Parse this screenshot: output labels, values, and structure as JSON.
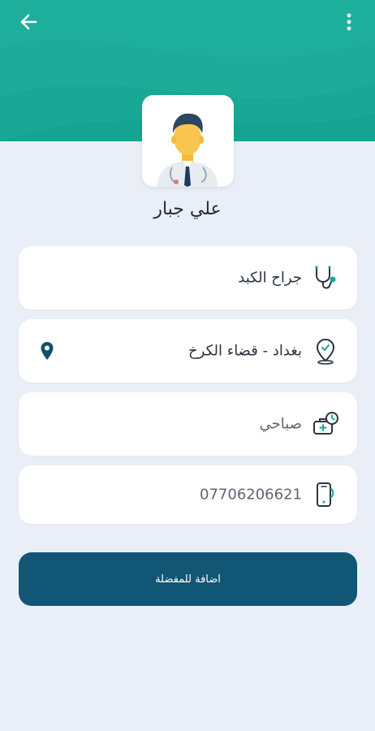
{
  "colors": {
    "header": "#1aa896",
    "accent": "#1aa896",
    "button": "#125676",
    "background": "#eaeff7",
    "pin": "#134e6f"
  },
  "header": {
    "back_icon": "arrow-left-icon",
    "menu_icon": "more-vertical-icon"
  },
  "doctor": {
    "name": "علي جبار",
    "avatar_icon": "doctor-avatar-icon"
  },
  "details": {
    "specialty": {
      "icon": "stethoscope-icon",
      "text": "جراح الكبد"
    },
    "location": {
      "icon": "location-pin-outline-icon",
      "text": "بغداد - قضاء الكرخ",
      "map_icon": "map-pin-icon"
    },
    "shift": {
      "icon": "doctor-bag-clock-icon",
      "text": "صباحي"
    },
    "phone": {
      "icon": "phone-icon",
      "text": "07706206621"
    }
  },
  "actions": {
    "add_favorite": "اضافة للمفضلة"
  }
}
